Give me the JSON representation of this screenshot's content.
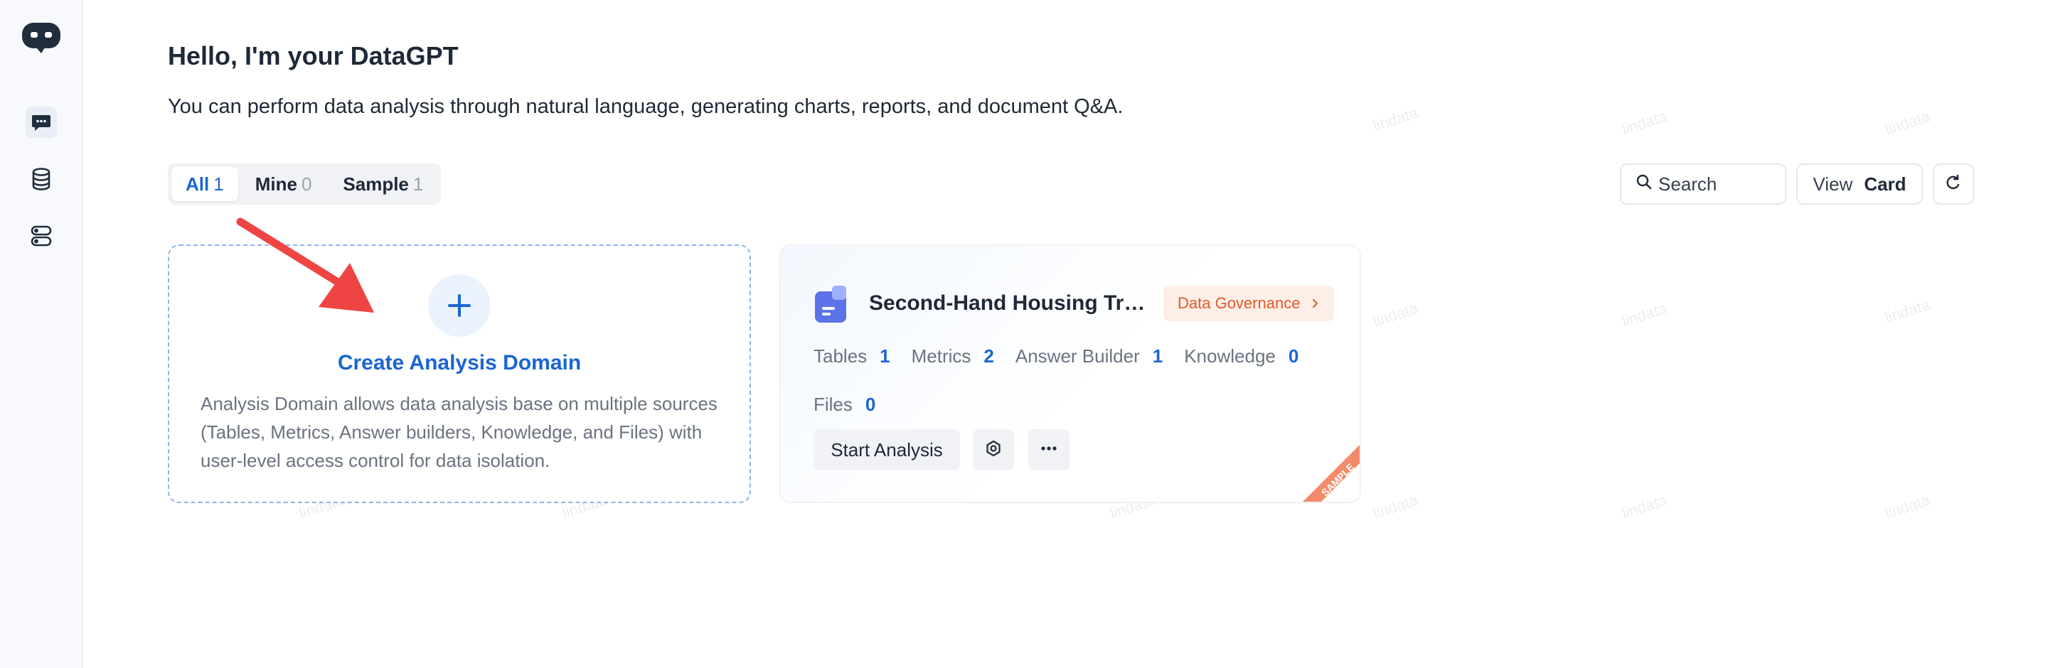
{
  "sidebar": {
    "items": [
      {
        "name": "chat-icon",
        "active": true
      },
      {
        "name": "database-icon",
        "active": false
      },
      {
        "name": "server-icon",
        "active": false
      }
    ]
  },
  "header": {
    "greeting": "Hello, I'm your DataGPT",
    "subtitle": "You can perform data analysis through natural language, generating charts, reports, and document Q&A."
  },
  "tabs": [
    {
      "label": "All",
      "count": "1",
      "active": true
    },
    {
      "label": "Mine",
      "count": "0",
      "active": false
    },
    {
      "label": "Sample",
      "count": "1",
      "active": false
    }
  ],
  "toolbar": {
    "search_placeholder": "Search",
    "view_label": "View",
    "view_value": "Card"
  },
  "create_card": {
    "title": "Create Analysis Domain",
    "description": "Analysis Domain allows data analysis base on multiple sources (Tables, Metrics, Answer builders, Knowledge, and Files) with user-level access control for data isolation."
  },
  "domain_card": {
    "title": "Second-Hand Housing Tra...",
    "badge": "Data Governance",
    "stats": [
      {
        "label": "Tables",
        "value": "1"
      },
      {
        "label": "Metrics",
        "value": "2"
      },
      {
        "label": "Answer Builder",
        "value": "1"
      },
      {
        "label": "Knowledge",
        "value": "0"
      },
      {
        "label": "Files",
        "value": "0"
      }
    ],
    "start_label": "Start Analysis",
    "ribbon": "SAMPLE"
  },
  "colors": {
    "accent": "#1a66d2",
    "badge_text": "#e05a2c",
    "badge_bg": "#fdeee8",
    "ribbon": "#f28b6c",
    "arrow": "#ef4444"
  }
}
